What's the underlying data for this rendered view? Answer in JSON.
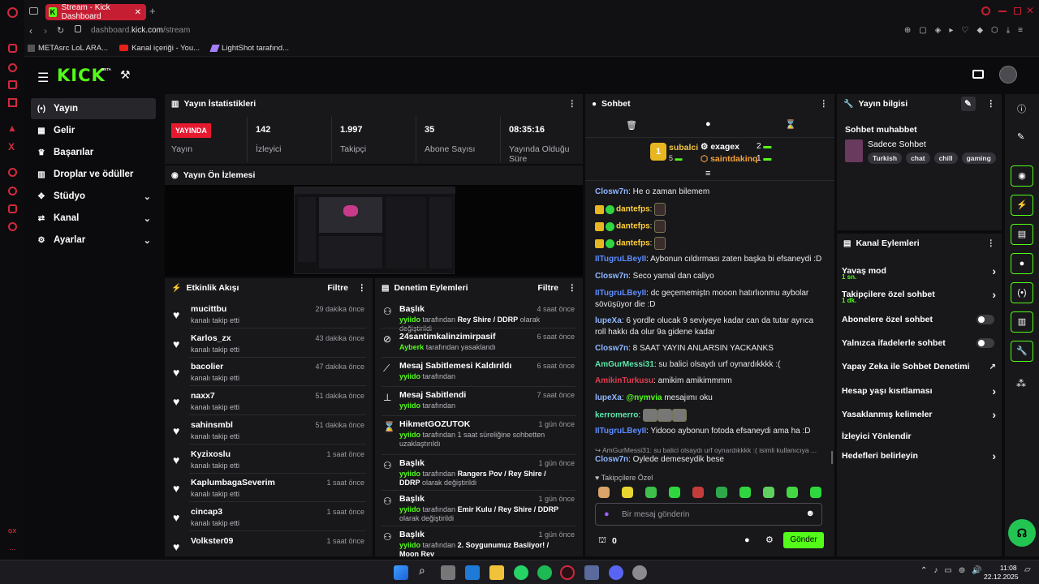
{
  "browser": {
    "tab_title": "Stream - Kick Dashboard",
    "tab_favicon": "K",
    "tab_close": "✕",
    "new_tab": "+",
    "url_domain": "dashboard.",
    "url_host": "kick.com",
    "url_path": "/stream",
    "bookmarks": [
      "METAsrc LoL ARA...",
      "Kanal içeriği - You...",
      "LightShot tarafınd..."
    ],
    "gx_label": "GX",
    "more": "···"
  },
  "app": {
    "logo": "KICK",
    "beta": "BETA",
    "accent": "#53fc18"
  },
  "sidebar": {
    "items": [
      {
        "label": "Yayın",
        "icon": "(•)"
      },
      {
        "label": "Gelir",
        "icon": "▦"
      },
      {
        "label": "Başarılar",
        "icon": "🏆"
      },
      {
        "label": "Droplar ve ödüller",
        "icon": "▥"
      },
      {
        "label": "Stüdyo",
        "icon": "✥"
      },
      {
        "label": "Kanal",
        "icon": "⇄"
      },
      {
        "label": "Ayarlar",
        "icon": "⚙"
      }
    ]
  },
  "stats": {
    "title": "Yayın İstatistikleri",
    "live_badge": "YAYINDA",
    "live_label": "Yayın",
    "items": [
      {
        "value": "142",
        "label": "İzleyici"
      },
      {
        "value": "1.997",
        "label": "Takipçi"
      },
      {
        "value": "35",
        "label": "Abone Sayısı"
      },
      {
        "value": "08:35:16",
        "label": "Yayında Olduğu Süre"
      }
    ]
  },
  "preview": {
    "title": "Yayın Ön İzlemesi"
  },
  "activity": {
    "title": "Etkinlik Akışı",
    "filter": "Filtre",
    "items": [
      {
        "name": "mucittbu",
        "sub": "kanalı takip etti",
        "time": "29 dakika önce"
      },
      {
        "name": "Karlos_zx",
        "sub": "kanalı takip etti",
        "time": "43 dakika önce"
      },
      {
        "name": "bacolier",
        "sub": "kanalı takip etti",
        "time": "47 dakika önce"
      },
      {
        "name": "naxx7",
        "sub": "kanalı takip etti",
        "time": "51 dakika önce"
      },
      {
        "name": "sahinsmbl",
        "sub": "kanalı takip etti",
        "time": "51 dakika önce"
      },
      {
        "name": "Kyzixoslu",
        "sub": "kanalı takip etti",
        "time": "1 saat önce"
      },
      {
        "name": "KaplumbagaSeverim",
        "sub": "kanalı takip etti",
        "time": "1 saat önce"
      },
      {
        "name": "cincap3",
        "sub": "kanalı takip etti",
        "time": "1 saat önce"
      },
      {
        "name": "Volkster09",
        "sub": "",
        "time": "1 saat önce"
      }
    ]
  },
  "moderation": {
    "title": "Denetim Eylemleri",
    "filter": "Filtre",
    "items": [
      {
        "icon": "⚇",
        "name": "Başlık",
        "time": "4 saat önce",
        "actor": "yyiido",
        "mid": " tarafından ",
        "obj": "Rey Shire / DDRP",
        "tail": " olarak değiştirildi"
      },
      {
        "icon": "⊘",
        "name": "24santimkalinzimirpasif",
        "time": "6 saat önce",
        "actor": "Ayberk",
        "mid": " tarafından yasaklandı",
        "obj": "",
        "tail": ""
      },
      {
        "icon": "⟋",
        "name": "Mesaj Sabitlemesi Kaldırıldı",
        "time": "6 saat önce",
        "actor": "yyiido",
        "mid": " tarafından",
        "obj": "",
        "tail": ""
      },
      {
        "icon": "⊥",
        "name": "Mesaj Sabitlendi",
        "time": "7 saat önce",
        "actor": "yyiido",
        "mid": " tarafından",
        "obj": "",
        "tail": ""
      },
      {
        "icon": "⌛",
        "name": "HikmetGOZUTOK",
        "time": "1 gün önce",
        "actor": "yyiido",
        "mid": " tarafından 1 saat süreliğine sohbetten uzaklaştırıldı",
        "obj": "",
        "tail": ""
      },
      {
        "icon": "⚇",
        "name": "Başlık",
        "time": "1 gün önce",
        "actor": "yyiido",
        "mid": " tarafından ",
        "obj": "Rangers Pov / Rey Shire / DDRP",
        "tail": " olarak değiştirildi"
      },
      {
        "icon": "⚇",
        "name": "Başlık",
        "time": "1 gün önce",
        "actor": "yyiido",
        "mid": " tarafından ",
        "obj": "Emir Kulu / Rey Shire / DDRP",
        "tail": " olarak değiştirildi"
      },
      {
        "icon": "⚇",
        "name": "Başlık",
        "time": "1 gün önce",
        "actor": "yyiido",
        "mid": " tarafından ",
        "obj": "2. Soygunumuz Basliyor! / Moon Rey",
        "tail": ""
      }
    ]
  },
  "chat": {
    "title": "Sohbet",
    "top": [
      {
        "name": "subalci",
        "count": "5",
        "rank": "1"
      },
      {
        "name": "exagex",
        "count": "2"
      },
      {
        "name": "saintdakinq",
        "count": "1"
      }
    ],
    "messages": [
      {
        "user": "Closw7n",
        "color": "#8fb7ff",
        "text": ": He o zaman bilemem"
      },
      {
        "user": "dantefps",
        "color": "#ffcf3a",
        "text": ":"
      },
      {
        "user": "dantefps",
        "color": "#ffcf3a",
        "text": ":"
      },
      {
        "user": "dantefps",
        "color": "#ffcf3a",
        "text": ":"
      },
      {
        "user": "IITugruLBeyII",
        "color": "#5c8dff",
        "text": ": Aybonun cıldırması zaten başka bi efsaneydi :D"
      },
      {
        "user": "Closw7n",
        "color": "#8fb7ff",
        "text": ": Seco yamal dan caliyo"
      },
      {
        "user": "IITugruLBeyII",
        "color": "#5c8dff",
        "text": ": dc geçememiştn mooon hatırlıonmu aybolar sövüşüyor die :D"
      },
      {
        "user": "lupeXa",
        "color": "#8fb7ff",
        "text": ": 6 yordle olucak 9 seviyeye kadar can da tutar ayrıca roll hakkı da olur 9a gidene kadar"
      },
      {
        "user": "Closw7n",
        "color": "#8fb7ff",
        "text": ": 8 SAAT YAYIN ANLARSIN YACKANKS"
      },
      {
        "user": "AmGurMessi31",
        "color": "#5ce6a8",
        "text": ": su balici olsaydı urf oynardıkkkk :("
      },
      {
        "user": "AmikinTurkusu",
        "color": "#e23d4f",
        "text": ": amikim amikimmmm"
      },
      {
        "user": "lupeXa",
        "color": "#8fb7ff",
        "text": ": ",
        "mention": "@nymvia",
        "text2": " mesajımı oku"
      },
      {
        "user": "kerromerro",
        "color": "#5ce6a8",
        "text": ":"
      },
      {
        "user": "IITugruLBeyII",
        "color": "#5c8dff",
        "text": ": Yidooo aybonun fotoda efsaneydi ama ha :D"
      }
    ],
    "reply_ref": "↪ AmGurMessi31: su balici olsaydı urf oynardıkkkk :( isimli kullanıcıya ...",
    "reply": {
      "user": "Closw7n",
      "text": ": Oylede demeseydik bese"
    },
    "emote_section": "♥ Takipçilere Özel",
    "input_placeholder": "Bir mesaj gönderin",
    "points": "0",
    "send": "Gönder"
  },
  "info": {
    "title": "Yayın bilgisi",
    "category_label": "Sohbet muhabbet",
    "subcategory": "Sadece Sohbet",
    "tags": [
      "Turkish",
      "chat",
      "chill",
      "gaming"
    ]
  },
  "channel_actions": {
    "title": "Kanal Eylemleri",
    "items": [
      {
        "label": "Yavaş mod",
        "sub": "1 sn.",
        "type": "arrow"
      },
      {
        "label": "Takipçilere özel sohbet",
        "sub": "1 dk.",
        "type": "arrow"
      },
      {
        "label": "Abonelere özel sohbet",
        "sub": "",
        "type": "toggle"
      },
      {
        "label": "Yalnızca ifadelerle sohbet",
        "sub": "",
        "type": "toggle"
      },
      {
        "label": "Yapay Zeka ile Sohbet Denetimi",
        "sub": "",
        "type": "external"
      },
      {
        "label": "Hesap yaşı kısıtlaması",
        "sub": "",
        "type": "arrow"
      },
      {
        "label": "Yasaklanmış kelimeler",
        "sub": "",
        "type": "arrow"
      },
      {
        "label": "İzleyici Yönlendir",
        "sub": "",
        "type": "none"
      },
      {
        "label": "Hedefleri belirleyin",
        "sub": "",
        "type": "arrow"
      }
    ]
  },
  "taskbar": {
    "time": "11:08",
    "date": "22.12.2025"
  }
}
